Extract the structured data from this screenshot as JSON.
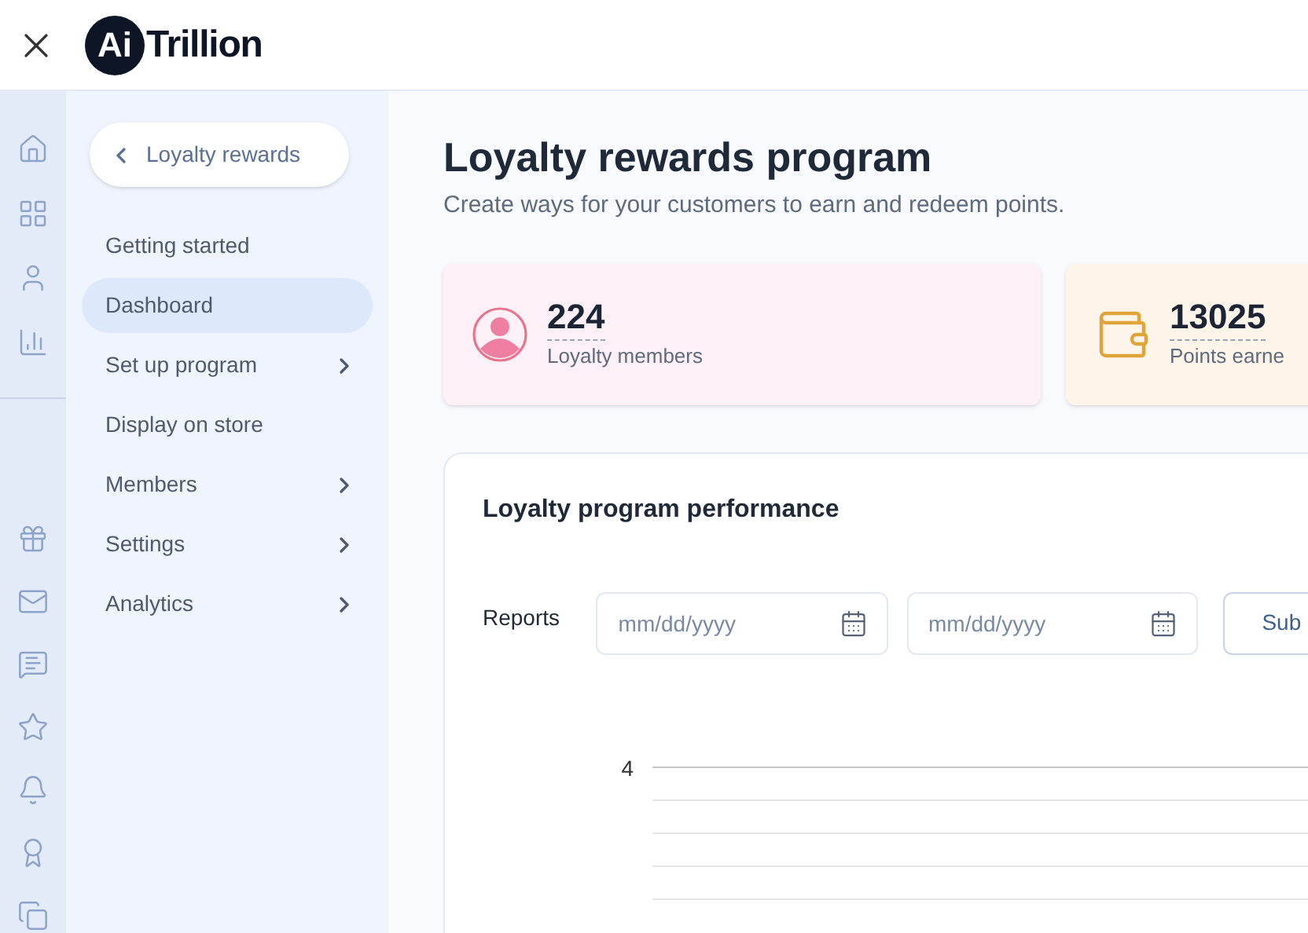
{
  "header": {
    "logo_mark": "Ai",
    "logo_text": "Trillion"
  },
  "rail": {
    "top_icons": [
      {
        "kind": "home"
      },
      {
        "kind": "grid"
      },
      {
        "kind": "user"
      },
      {
        "kind": "chart"
      }
    ],
    "bottom_icons": [
      {
        "kind": "gift"
      },
      {
        "kind": "mail"
      },
      {
        "kind": "message"
      },
      {
        "kind": "star"
      },
      {
        "kind": "bell"
      },
      {
        "kind": "award"
      },
      {
        "kind": "copy"
      }
    ]
  },
  "sidebar": {
    "back_label": "Loyalty rewards",
    "items": [
      {
        "label": "Getting started",
        "selected": false,
        "has_submenu": false
      },
      {
        "label": "Dashboard",
        "selected": true,
        "has_submenu": false
      },
      {
        "label": "Set up program",
        "selected": false,
        "has_submenu": true
      },
      {
        "label": "Display on store",
        "selected": false,
        "has_submenu": false
      },
      {
        "label": "Members",
        "selected": false,
        "has_submenu": true
      },
      {
        "label": "Settings",
        "selected": false,
        "has_submenu": true
      },
      {
        "label": "Analytics",
        "selected": false,
        "has_submenu": true
      }
    ]
  },
  "page": {
    "title": "Loyalty rewards program",
    "subtitle": "Create ways for your customers to earn and redeem points."
  },
  "stats": [
    {
      "kind": "members",
      "value": "224",
      "label": "Loyalty members"
    },
    {
      "kind": "points",
      "value": "13025",
      "label": "Points earne"
    }
  ],
  "performance": {
    "title": "Loyalty program performance",
    "reports_label": "Reports",
    "date_fields": [
      {
        "placeholder": "mm/dd/yyyy"
      },
      {
        "placeholder": "mm/dd/yyyy"
      }
    ],
    "submit_label": "Sub",
    "chart": {
      "top_tick": "4"
    }
  }
}
